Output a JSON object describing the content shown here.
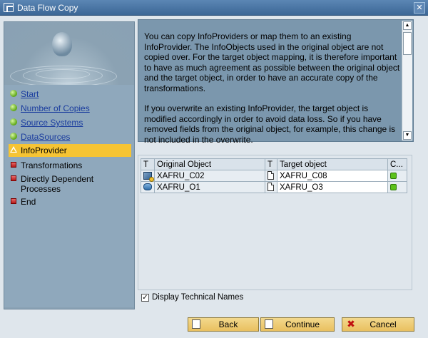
{
  "window": {
    "title": "Data Flow Copy",
    "close_glyph": "✕"
  },
  "steps": [
    {
      "label": "Start",
      "state": "done"
    },
    {
      "label": "Number of Copies",
      "state": "done"
    },
    {
      "label": "Source Systems",
      "state": "done"
    },
    {
      "label": "DataSources",
      "state": "done"
    },
    {
      "label": "InfoProvider",
      "state": "current"
    },
    {
      "label": "Transformations",
      "state": "pending"
    },
    {
      "label": "Directly Dependent Processes",
      "state": "pending"
    },
    {
      "label": "End",
      "state": "pending"
    }
  ],
  "info": {
    "paragraph1": "You can copy InfoProviders or map them to an existing InfoProvider. The InfoObjects used in the original object are not copied over. For the target object mapping, it is therefore important to have as much agreement as possible between the original object and the target object, in order to have an accurate copy of the transformations.",
    "paragraph2": "If you overwrite an existing InfoProvider, the target object is modified accordingly in order to avoid data loss. So if you have removed fields from the original object, for example, this change is not included in the overwrite."
  },
  "table": {
    "headers": [
      "T",
      "Original Object",
      "T",
      "Target object",
      "C..."
    ],
    "rows": [
      {
        "orig_icon": "infocube-icon",
        "original": "XAFRU_C02",
        "target_icon": "document-icon",
        "target": "XAFRU_C08",
        "status": "green"
      },
      {
        "orig_icon": "datastore-icon",
        "original": "XAFRU_O1",
        "target_icon": "document-icon",
        "target": "XAFRU_O3",
        "status": "green"
      }
    ]
  },
  "options": {
    "display_technical_names": "Display Technical Names",
    "checked": true
  },
  "buttons": {
    "back": "Back",
    "continue": "Continue",
    "cancel": "Cancel"
  },
  "colors": {
    "active_step": "#f6c434",
    "panel": "#7b97ad",
    "status_green": "#5dc21a"
  }
}
